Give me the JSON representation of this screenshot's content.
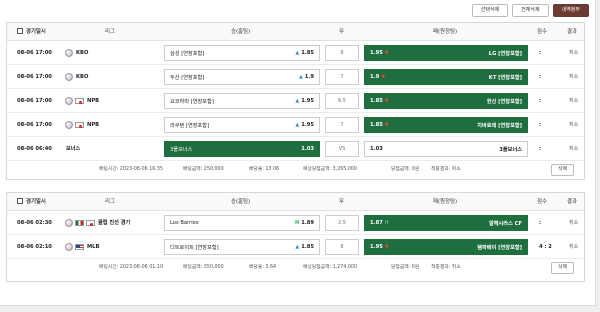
{
  "toolbar": {
    "select_delete": "선택삭제",
    "delete_all": "전체삭제",
    "history": "내역정부"
  },
  "headers": {
    "date": "경기일시",
    "league": "리그",
    "home": "승(홈팀)",
    "draw": "무",
    "away": "패(원정팀)",
    "score": "점수",
    "result": "결과"
  },
  "slips": [
    {
      "rows": [
        {
          "date": "08-06 17:00",
          "league": "KBO",
          "flag": "",
          "home": "삼성 [연장포함]",
          "home_odds": "1.85",
          "home_mark": "up",
          "home_sel": false,
          "draw": "8",
          "away": "LG [연장포함]",
          "away_odds": "1.95",
          "away_mark": "dn",
          "away_sel": true,
          "score": ":",
          "result": "취소"
        },
        {
          "date": "08-06 17:00",
          "league": "KBO",
          "flag": "",
          "home": "두산 [연장포함]",
          "home_odds": "1.9",
          "home_mark": "up",
          "home_sel": false,
          "draw": "7",
          "away": "KT [연장포함]",
          "away_odds": "1.9",
          "away_mark": "dn",
          "away_sel": true,
          "score": ":",
          "result": "취소"
        },
        {
          "date": "08-06 17:00",
          "league": "NPB",
          "flag": "jp",
          "home": "요코하마 [연장포함]",
          "home_odds": "1.95",
          "home_mark": "up",
          "home_sel": false,
          "draw": "6.5",
          "away": "한신 [연장포함]",
          "away_odds": "1.85",
          "away_mark": "dn",
          "away_sel": true,
          "score": ":",
          "result": "취소"
        },
        {
          "date": "08-06 17:00",
          "league": "NPB",
          "flag": "jp",
          "home": "라쿠텐 [연장포함]",
          "home_odds": "1.95",
          "home_mark": "up",
          "home_sel": false,
          "draw": "7",
          "away": "치바로데 [연장포함]",
          "away_odds": "1.85",
          "away_mark": "dn",
          "away_sel": true,
          "score": ":",
          "result": "취소"
        },
        {
          "date": "08-06 06:40",
          "league": "보너스",
          "flag": "none",
          "home": "3폴보너스",
          "home_odds": "1.03",
          "home_mark": "",
          "home_sel": true,
          "draw": "VS",
          "away": "3폴보너스",
          "away_odds": "1.03",
          "away_mark": "",
          "away_sel": false,
          "score": ":",
          "result": "취소"
        }
      ],
      "summary": {
        "bet_time": "배팅시간: 2023-08-06 16:35",
        "bet_amount": "배팅금액: 250,000",
        "bet_odds": "배당율: 13.06",
        "expected": "예상당첨금액: 3,265,000",
        "won": "당첨금액: 0원",
        "result": "적중결과: 취소"
      },
      "delete_label": "삭제"
    },
    {
      "rows": [
        {
          "date": "08-06 02:30",
          "league": "클럽 친선 경기",
          "flag": "intl",
          "home": "Los Barrios",
          "home_odds": "1.89",
          "home_mark": "hi",
          "home_sel": false,
          "draw": "2.5",
          "away": "알헤시라스 CF",
          "away_odds": "1.87",
          "away_mark": "hi",
          "away_sel": true,
          "score": ":",
          "result": "취소"
        },
        {
          "date": "08-06 02:10",
          "league": "MLB",
          "flag": "us",
          "home": "디트로이트 [연장포함]",
          "home_odds": "1.85",
          "home_mark": "up",
          "home_sel": false,
          "draw": "8",
          "away": "탬파베이 [연장포함]",
          "away_odds": "1.95",
          "away_mark": "dn",
          "away_sel": true,
          "score": "4 : 2",
          "result": "취소"
        }
      ],
      "summary": {
        "bet_time": "배팅시간: 2023-08-06 01:10",
        "bet_amount": "배팅금액: 350,000",
        "bet_odds": "배당율: 3.64",
        "expected": "예상당첨금액: 1,274,000",
        "won": "당첨금액: 0원",
        "result": "적중결과: 취소"
      },
      "delete_label": "삭제"
    }
  ],
  "icons": {
    "up": "▲",
    "dn": "▼",
    "hi": "H"
  },
  "colors": {
    "selected_green": "#1f6e3f",
    "history_button": "#6b3b33",
    "odds_up": "#3a8fd0",
    "odds_down": "#e04b3b"
  }
}
